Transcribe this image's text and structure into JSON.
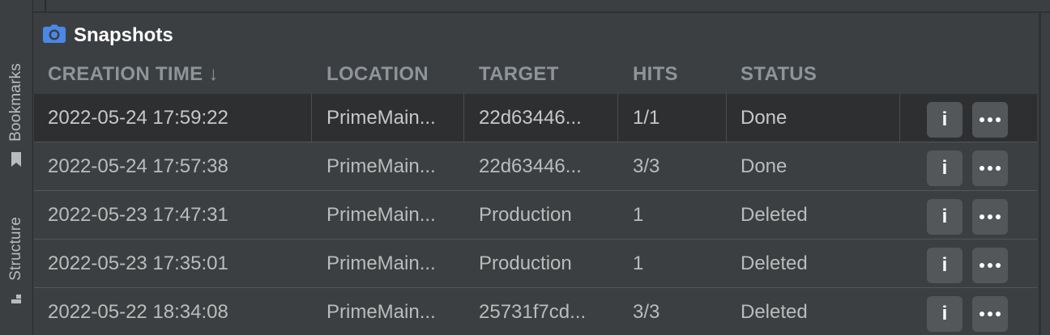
{
  "sidebar": {
    "bookmarks_label": "Bookmarks",
    "structure_label": "Structure"
  },
  "panel": {
    "title": "Snapshots",
    "icon": "camera-icon",
    "accent_color": "#4a88e8"
  },
  "table": {
    "headers": {
      "creation_time": "CREATION TIME ↓",
      "location": "LOCATION",
      "target": "TARGET",
      "hits": "HITS",
      "status": "STATUS"
    },
    "rows": [
      {
        "time": "2022-05-24 17:59:22",
        "location": "PrimeMain...",
        "target": "22d63446...",
        "hits": "1/1",
        "status": "Done",
        "info": "i"
      },
      {
        "time": "2022-05-24 17:57:38",
        "location": "PrimeMain...",
        "target": "22d63446...",
        "hits": "3/3",
        "status": "Done",
        "info": "i"
      },
      {
        "time": "2022-05-23 17:47:31",
        "location": "PrimeMain...",
        "target": "Production",
        "hits": "1",
        "status": "Deleted",
        "info": "i"
      },
      {
        "time": "2022-05-23 17:35:01",
        "location": "PrimeMain...",
        "target": "Production",
        "hits": "1",
        "status": "Deleted",
        "info": "i"
      },
      {
        "time": "2022-05-22 18:34:08",
        "location": "PrimeMain...",
        "target": "25731f7cd...",
        "hits": "3/3",
        "status": "Deleted",
        "info": "i"
      }
    ]
  }
}
